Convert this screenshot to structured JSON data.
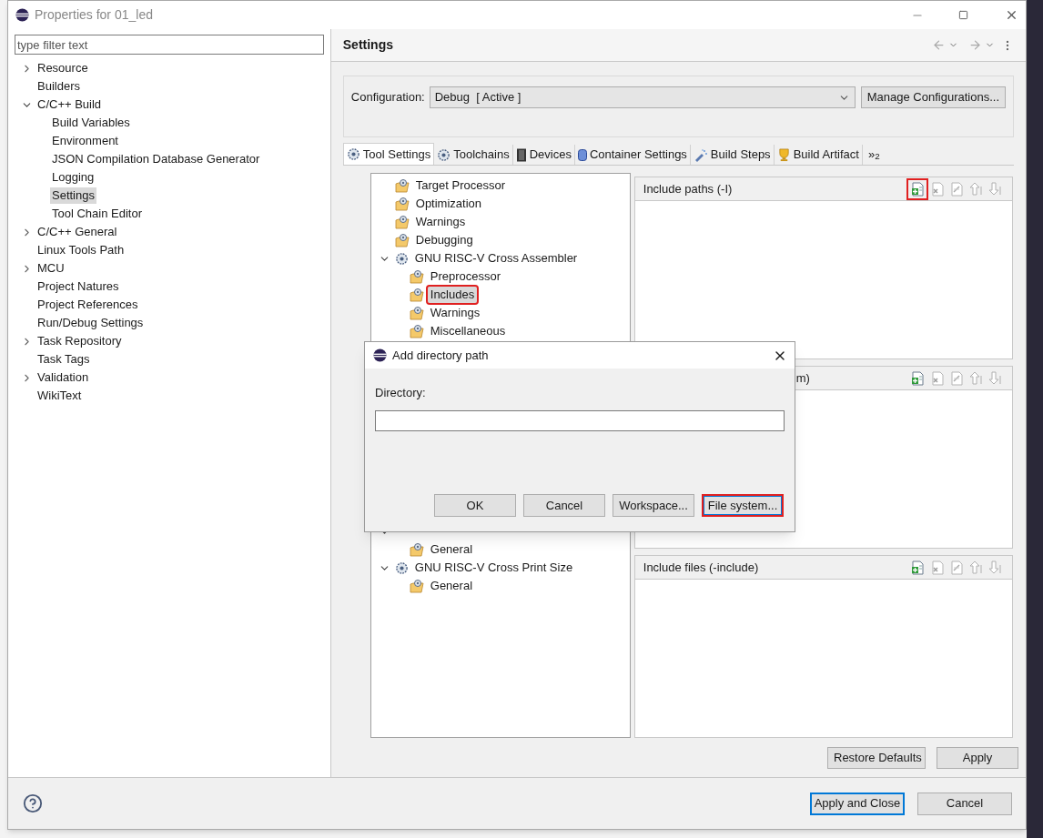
{
  "window": {
    "title": "Properties for 01_led"
  },
  "filter": {
    "placeholder": "type filter text"
  },
  "nav_tree": [
    {
      "label": "Resource",
      "expanded": false,
      "selected": false
    },
    {
      "label": "Builders",
      "selected": false
    },
    {
      "label": "C/C++ Build",
      "expanded": true,
      "selected": false,
      "children": [
        {
          "label": "Build Variables",
          "selected": false
        },
        {
          "label": "Environment",
          "selected": false
        },
        {
          "label": "JSON Compilation Database Generator",
          "selected": false
        },
        {
          "label": "Logging",
          "selected": false
        },
        {
          "label": "Settings",
          "selected": true
        },
        {
          "label": "Tool Chain Editor",
          "selected": false
        }
      ]
    },
    {
      "label": "C/C++ General",
      "expanded": false,
      "selected": false
    },
    {
      "label": "Linux Tools Path",
      "selected": false
    },
    {
      "label": "MCU",
      "expanded": false,
      "selected": false
    },
    {
      "label": "Project Natures",
      "selected": false
    },
    {
      "label": "Project References",
      "selected": false
    },
    {
      "label": "Run/Debug Settings",
      "selected": false
    },
    {
      "label": "Task Repository",
      "expanded": false,
      "selected": false
    },
    {
      "label": "Task Tags",
      "selected": false
    },
    {
      "label": "Validation",
      "expanded": false,
      "selected": false
    },
    {
      "label": "WikiText",
      "selected": false
    }
  ],
  "page": {
    "title": "Settings"
  },
  "configuration": {
    "label": "Configuration:",
    "value": "Debug  [ Active ]",
    "manage_button": "Manage Configurations..."
  },
  "tabs": [
    {
      "label": "Tool Settings",
      "kind": "gear",
      "selected": true
    },
    {
      "label": "Toolchains",
      "kind": "gear",
      "selected": false
    },
    {
      "label": "Devices",
      "kind": "chip",
      "selected": false
    },
    {
      "label": "Container Settings",
      "kind": "container",
      "selected": false
    },
    {
      "label": "Build Steps",
      "kind": "spray",
      "selected": false
    },
    {
      "label": "Build Artifact",
      "kind": "trophy",
      "selected": false
    }
  ],
  "tabs_overflow": "»$_{2}$",
  "tool_tree": [
    {
      "kind": "category",
      "label": "Target Processor",
      "highlighted": false
    },
    {
      "kind": "category",
      "label": "Optimization",
      "highlighted": false
    },
    {
      "kind": "category",
      "label": "Warnings",
      "highlighted": false
    },
    {
      "kind": "category",
      "label": "Debugging",
      "highlighted": false
    },
    {
      "kind": "tool",
      "label": "GNU RISC-V Cross Assembler",
      "expanded": true,
      "children": [
        {
          "kind": "category",
          "label": "Preprocessor",
          "highlighted": false
        },
        {
          "kind": "category",
          "label": "Includes",
          "highlighted": true
        },
        {
          "kind": "category",
          "label": "Warnings",
          "highlighted": false
        },
        {
          "kind": "category",
          "label": "Miscellaneous",
          "highlighted": false
        }
      ]
    }
  ],
  "tool_tree_lower": [
    {
      "kind": "tool",
      "expanded": true,
      "children": [
        {
          "kind": "category",
          "label": "General",
          "highlighted": false
        }
      ]
    },
    {
      "kind": "tool",
      "label": "GNU RISC-V Cross Print Size",
      "expanded": true,
      "children": [
        {
          "kind": "category",
          "label": "General",
          "highlighted": false
        }
      ]
    }
  ],
  "sections": [
    {
      "label": "Include paths (-I)",
      "add_highlighted": true
    },
    {
      "label": "m)",
      "add_highlighted": false
    },
    {
      "label": "Include files (-include)",
      "add_highlighted": false
    }
  ],
  "page_buttons": [
    "Restore Defaults",
    "Apply"
  ],
  "bottom_buttons": [
    {
      "label": "Apply and Close",
      "default": true
    },
    {
      "label": "Cancel",
      "default": false
    }
  ],
  "dialog": {
    "title": "Add directory path",
    "field_label": "Directory:",
    "buttons": [
      {
        "label": "OK",
        "highlighted": false
      },
      {
        "label": "Cancel",
        "highlighted": false
      },
      {
        "label": "Workspace...",
        "highlighted": false
      },
      {
        "label": "File system...",
        "highlighted": true
      }
    ]
  }
}
